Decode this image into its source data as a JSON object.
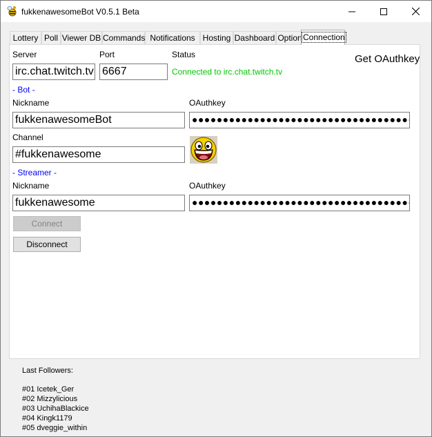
{
  "window": {
    "title": "fukkenawesomeBot V0.5.1 Beta",
    "icon": "bee-icon",
    "controls": [
      "minimize-icon",
      "maximize-icon",
      "close-icon"
    ]
  },
  "tabs": [
    {
      "label": "Lottery",
      "active": false
    },
    {
      "label": "Poll",
      "active": false
    },
    {
      "label": "Viewer DB",
      "active": false
    },
    {
      "label": "Commands",
      "active": false
    },
    {
      "label": "Notifications",
      "active": false
    },
    {
      "label": "Hosting",
      "active": false
    },
    {
      "label": "Dashboard",
      "active": false
    },
    {
      "label": "Options",
      "active": false
    },
    {
      "label": "Connection",
      "active": true
    }
  ],
  "connection": {
    "server_label": "Server",
    "server_value": "irc.chat.twitch.tv",
    "port_label": "Port",
    "port_value": "6667",
    "status_label": "Status",
    "status_value": "Connected to irc.chat.twitch.tv",
    "status_color": "#00c800",
    "get_oauth_label": "Get OAuthkey",
    "bot_section": "- Bot -",
    "bot_nick_label": "Nickname",
    "bot_nick_value": "fukkenawesomeBot",
    "bot_oauth_label": "OAuthkey",
    "bot_oauth_value": "●●●●●●●●●●●●●●●●●●●●●●●●●●●●●●●●●●●●",
    "channel_label": "Channel",
    "channel_value": "#fukkenawesome",
    "channel_avatar": "awesome-face-emoji",
    "streamer_section": "- Streamer -",
    "streamer_nick_label": "Nickname",
    "streamer_nick_value": "fukkenawesome",
    "streamer_oauth_label": "OAuthkey",
    "streamer_oauth_value": "●●●●●●●●●●●●●●●●●●●●●●●●●●●●●●●●●●●●",
    "connect_label": "Connect",
    "disconnect_label": "Disconnect",
    "section_color": "#0000ff"
  },
  "followers": {
    "title": "Last Followers:",
    "items": [
      "#01 Icetek_Ger",
      "#02 Mizzylicious",
      "#03 UchihaBlackice",
      "#04 Kingk1179",
      "#05 dveggie_within"
    ]
  }
}
